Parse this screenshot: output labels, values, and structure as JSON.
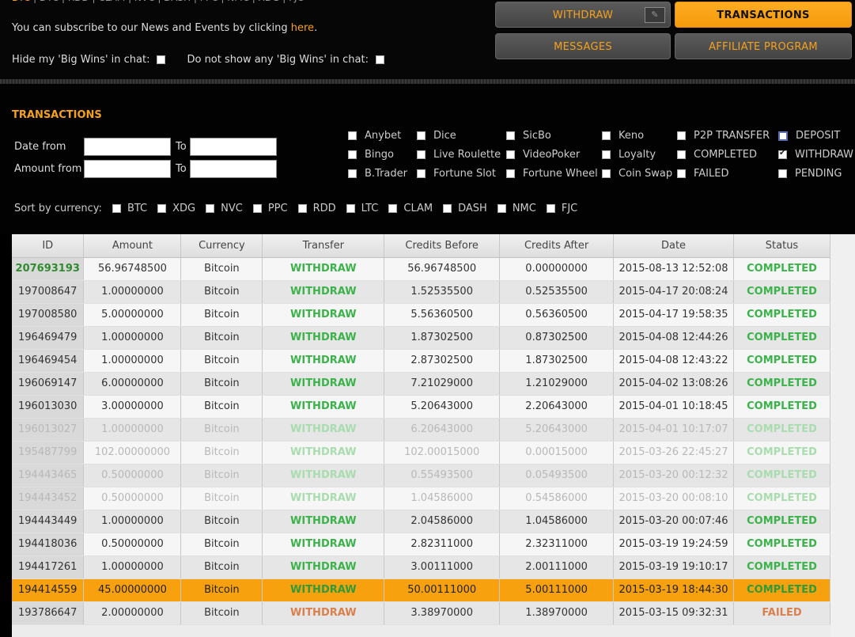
{
  "top": {
    "crumbs": [
      "BTC",
      "DTC",
      "RDD",
      "CLAM",
      "NVC",
      "DASH",
      "PPC",
      "NMC",
      "XDG",
      "FJC"
    ],
    "subscribe_text": "You can subscribe to our News and Events by clicking ",
    "subscribe_link": "here",
    "subscribe_end": ".",
    "hide_big_wins": "Hide my 'Big Wins' in chat:",
    "no_big_wins": "Do not show any 'Big Wins' in chat:"
  },
  "nav": {
    "withdraw": "WITHDRAW",
    "transactions": "TRANSACTIONS",
    "messages": "MESSAGES",
    "affiliate": "AFFILIATE PROGRAM"
  },
  "filters": {
    "title": "TRANSACTIONS",
    "date_from": "Date from",
    "amount_from": "Amount from",
    "to": "To",
    "games": [
      {
        "label": "Anybet",
        "checked": false
      },
      {
        "label": "Dice",
        "checked": false
      },
      {
        "label": "SicBo",
        "checked": false
      },
      {
        "label": "Keno",
        "checked": false
      },
      {
        "label": "P2P TRANSFER",
        "checked": false
      },
      {
        "label": "DEPOSIT",
        "checked": false
      },
      {
        "label": "Bingo",
        "checked": false
      },
      {
        "label": "Live Roulette",
        "checked": false
      },
      {
        "label": "VideoPoker",
        "checked": false
      },
      {
        "label": "Loyalty",
        "checked": false
      },
      {
        "label": "COMPLETED",
        "checked": false
      },
      {
        "label": "WITHDRAW",
        "checked": true
      },
      {
        "label": "B.Trader",
        "checked": false
      },
      {
        "label": "Fortune Slot",
        "checked": false
      },
      {
        "label": "Fortune Wheel",
        "checked": false
      },
      {
        "label": "Coin Swap",
        "checked": false
      },
      {
        "label": "FAILED",
        "checked": false
      },
      {
        "label": "PENDING",
        "checked": false
      }
    ],
    "sort_label": "Sort by currency:",
    "currencies": [
      "BTC",
      "XDG",
      "NVC",
      "PPC",
      "RDD",
      "LTC",
      "CLAM",
      "DASH",
      "NMC",
      "FJC"
    ]
  },
  "table": {
    "headers": [
      "ID",
      "Amount",
      "Currency",
      "Transfer",
      "Credits Before",
      "Credits After",
      "Date",
      "Status"
    ],
    "rows": [
      [
        "207693193",
        "56.96748500",
        "Bitcoin",
        "WITHDRAW",
        "56.96748500",
        "0.00000000",
        "2015-08-13 12:52:08",
        "COMPLETED"
      ],
      [
        "197008647",
        "1.00000000",
        "Bitcoin",
        "WITHDRAW",
        "1.52535500",
        "0.52535500",
        "2015-04-17 20:08:24",
        "COMPLETED"
      ],
      [
        "197008580",
        "5.00000000",
        "Bitcoin",
        "WITHDRAW",
        "5.56360500",
        "0.56360500",
        "2015-04-17 19:58:35",
        "COMPLETED"
      ],
      [
        "196469479",
        "1.00000000",
        "Bitcoin",
        "WITHDRAW",
        "1.87302500",
        "0.87302500",
        "2015-04-08 12:44:26",
        "COMPLETED"
      ],
      [
        "196469454",
        "1.00000000",
        "Bitcoin",
        "WITHDRAW",
        "2.87302500",
        "1.87302500",
        "2015-04-08 12:43:22",
        "COMPLETED"
      ],
      [
        "196069147",
        "6.00000000",
        "Bitcoin",
        "WITHDRAW",
        "7.21029000",
        "1.21029000",
        "2015-04-02 13:08:26",
        "COMPLETED"
      ],
      [
        "196013030",
        "3.00000000",
        "Bitcoin",
        "WITHDRAW",
        "5.20643000",
        "2.20643000",
        "2015-04-01 10:18:45",
        "COMPLETED"
      ],
      [
        "196013027",
        "1.00000000",
        "Bitcoin",
        "WITHDRAW",
        "6.20643000",
        "5.20643000",
        "2015-04-01 10:17:07",
        "COMPLETED"
      ],
      [
        "195487799",
        "102.00000000",
        "Bitcoin",
        "WITHDRAW",
        "102.00015000",
        "0.00015000",
        "2015-03-26 22:45:27",
        "COMPLETED"
      ],
      [
        "194443465",
        "0.50000000",
        "Bitcoin",
        "WITHDRAW",
        "0.55493500",
        "0.05493500",
        "2015-03-20 00:12:32",
        "COMPLETED"
      ],
      [
        "194443452",
        "0.50000000",
        "Bitcoin",
        "WITHDRAW",
        "1.04586000",
        "0.54586000",
        "2015-03-20 00:08:10",
        "COMPLETED"
      ],
      [
        "194443449",
        "1.00000000",
        "Bitcoin",
        "WITHDRAW",
        "2.04586000",
        "1.04586000",
        "2015-03-20 00:07:46",
        "COMPLETED"
      ],
      [
        "194418036",
        "0.50000000",
        "Bitcoin",
        "WITHDRAW",
        "2.82311000",
        "2.32311000",
        "2015-03-19 19:24:59",
        "COMPLETED"
      ],
      [
        "194417261",
        "1.00000000",
        "Bitcoin",
        "WITHDRAW",
        "3.00111000",
        "2.00111000",
        "2015-03-19 19:10:17",
        "COMPLETED"
      ],
      [
        "194414559",
        "45.00000000",
        "Bitcoin",
        "WITHDRAW",
        "50.00111000",
        "5.00111000",
        "2015-03-19 18:44:30",
        "COMPLETED"
      ],
      [
        "193786647",
        "2.00000000",
        "Bitcoin",
        "WITHDRAW",
        "3.38970000",
        "1.38970000",
        "2015-03-15 09:32:31",
        "FAILED"
      ]
    ]
  }
}
